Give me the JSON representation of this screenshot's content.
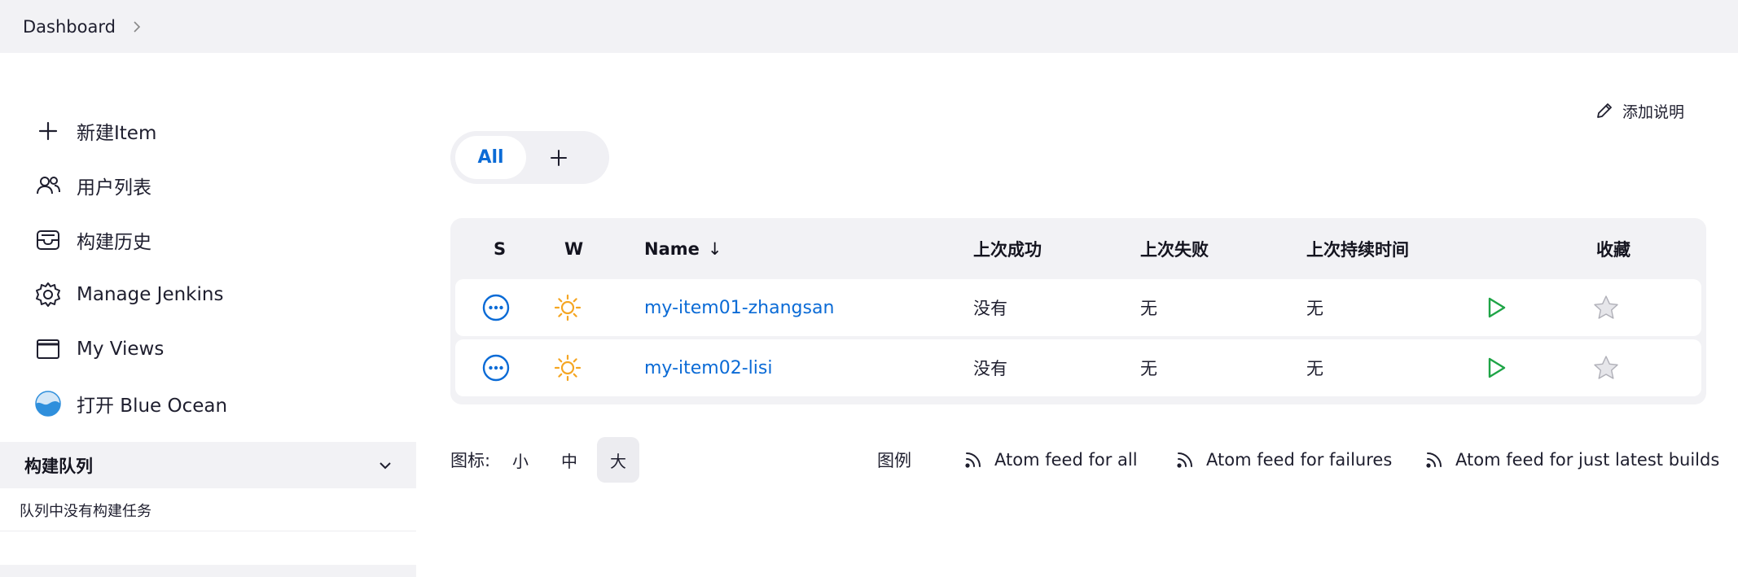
{
  "breadcrumb": {
    "items": [
      "Dashboard"
    ]
  },
  "sidebar": {
    "items": [
      {
        "label": "新建Item",
        "icon": "plus-icon"
      },
      {
        "label": "用户列表",
        "icon": "users-icon"
      },
      {
        "label": "构建历史",
        "icon": "inbox-icon"
      },
      {
        "label": "Manage Jenkins",
        "icon": "gear-icon"
      },
      {
        "label": "My Views",
        "icon": "window-icon"
      },
      {
        "label": "打开 Blue Ocean",
        "icon": "blue-ocean-icon"
      }
    ]
  },
  "build_queue": {
    "title": "构建队列",
    "empty_text": "队列中没有构建任务"
  },
  "add_description": {
    "label": "添加说明"
  },
  "view_tabs": {
    "all_label": "All"
  },
  "table": {
    "headers": {
      "s": "S",
      "w": "W",
      "name": "Name",
      "sort_arrow": "↓",
      "last_success": "上次成功",
      "last_failure": "上次失败",
      "last_duration": "上次持续时间",
      "favorite": "收藏"
    },
    "rows": [
      {
        "name": "my-item01-zhangsan",
        "last_success": "没有",
        "last_failure": "无",
        "last_duration": "无"
      },
      {
        "name": "my-item02-lisi",
        "last_success": "没有",
        "last_failure": "无",
        "last_duration": "无"
      }
    ]
  },
  "footer": {
    "icon_label": "图标:",
    "sizes": [
      "小",
      "中",
      "大"
    ],
    "active_size": "大",
    "legend": "图例",
    "feeds": [
      "Atom feed for all",
      "Atom feed for failures",
      "Atom feed for just latest builds"
    ]
  },
  "colors": {
    "link": "#0b6bd6",
    "weather_sun": "#f5a623",
    "build_play": "#1ea446",
    "panel_bg": "#f2f2f5"
  }
}
